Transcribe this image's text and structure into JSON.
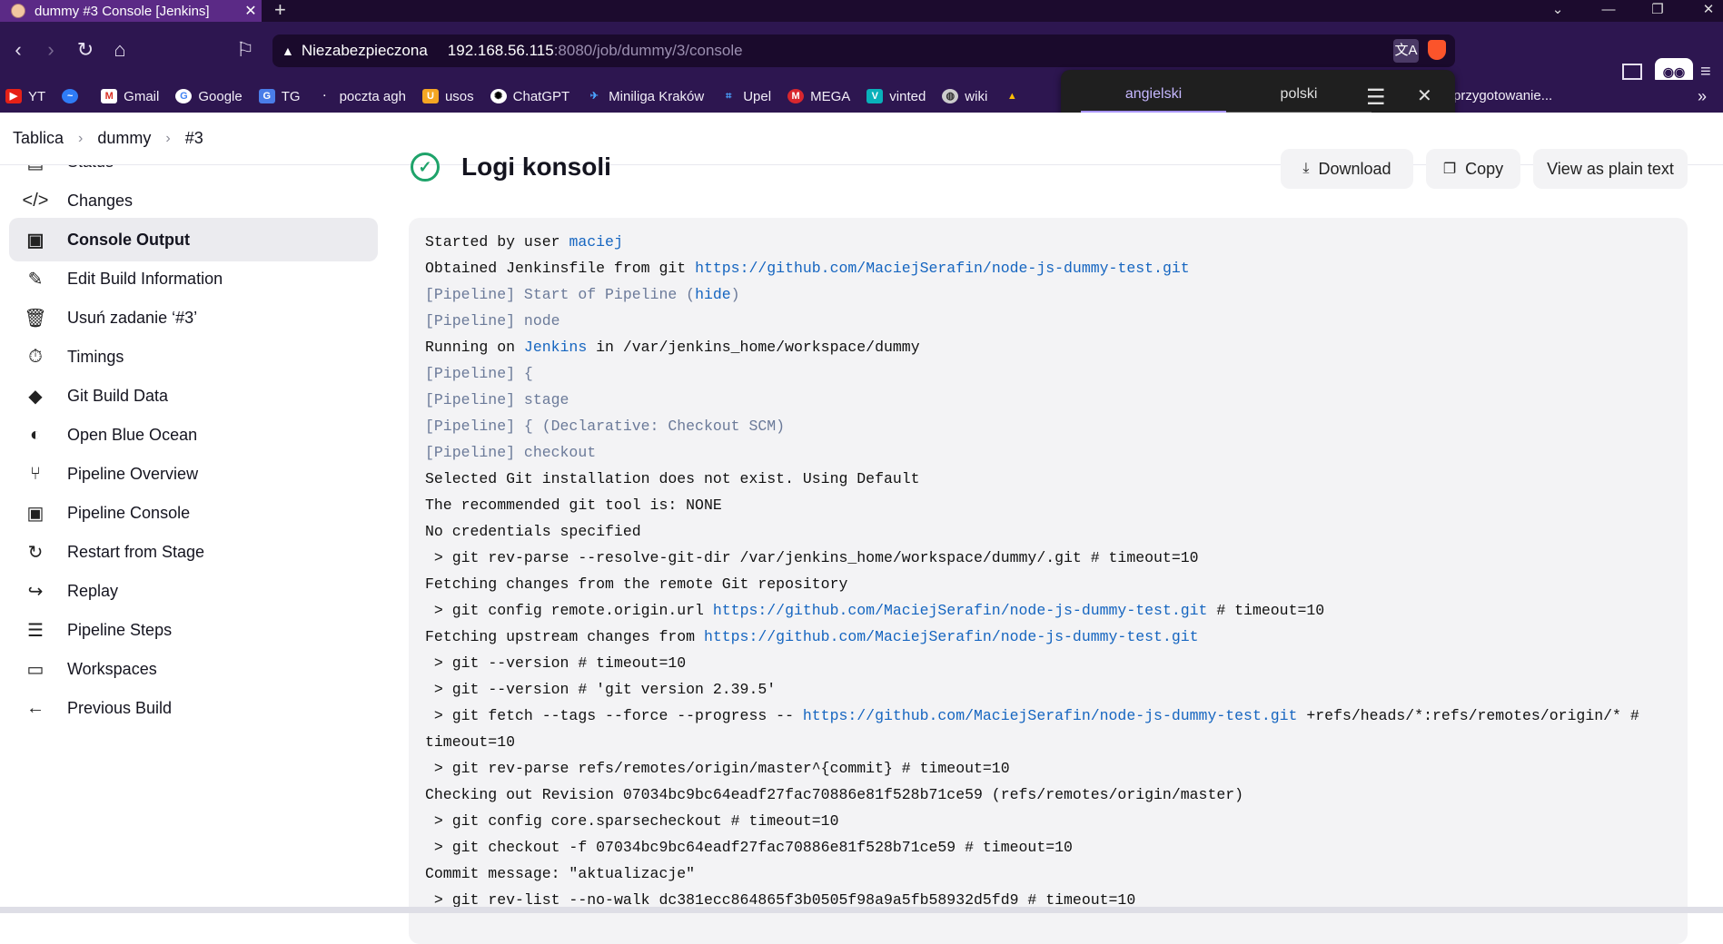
{
  "browser": {
    "tab_title": "dummy #3 Console [Jenkins]",
    "url_security": "Niezabezpieczona",
    "url_host": "192.168.56.115",
    "url_path": ":8080/job/dummy/3/console",
    "bookmarks": [
      "YT",
      "Gmail",
      "Google",
      "TG",
      "poczta agh",
      "usos",
      "ChatGPT",
      "Miniliga Kraków",
      "Upel",
      "MEGA",
      "vinted",
      "wiki"
    ],
    "bookmark_overflow": "przygotowanie..."
  },
  "translate_popup": {
    "lang_from": "angielski",
    "lang_to": "polski"
  },
  "breadcrumb": [
    "Tablica",
    "dummy",
    "#3"
  ],
  "sidebar": [
    {
      "label": "Status",
      "icon": "status-icon",
      "glyph": "▤"
    },
    {
      "label": "Changes",
      "icon": "code-icon",
      "glyph": "</>"
    },
    {
      "label": "Console Output",
      "icon": "terminal-icon",
      "glyph": "▣",
      "active": true
    },
    {
      "label": "Edit Build Information",
      "icon": "edit-icon",
      "glyph": "✎"
    },
    {
      "label": "Usuń zadanie ‘#3’",
      "icon": "trash-icon",
      "glyph": "🗑"
    },
    {
      "label": "Timings",
      "icon": "stopwatch-icon",
      "glyph": "⏱"
    },
    {
      "label": "Git Build Data",
      "icon": "git-icon",
      "glyph": "◆"
    },
    {
      "label": "Open Blue Ocean",
      "icon": "blue-ocean-icon",
      "glyph": "◐"
    },
    {
      "label": "Pipeline Overview",
      "icon": "pipeline-graph-icon",
      "glyph": "⑂"
    },
    {
      "label": "Pipeline Console",
      "icon": "terminal-icon",
      "glyph": "▣"
    },
    {
      "label": "Restart from Stage",
      "icon": "restart-icon",
      "glyph": "↻"
    },
    {
      "label": "Replay",
      "icon": "replay-icon",
      "glyph": "↪"
    },
    {
      "label": "Pipeline Steps",
      "icon": "list-icon",
      "glyph": "☰"
    },
    {
      "label": "Workspaces",
      "icon": "folder-icon",
      "glyph": "▭"
    },
    {
      "label": "Previous Build",
      "icon": "arrow-left-icon",
      "glyph": "←"
    }
  ],
  "main": {
    "title": "Logi konsoli",
    "download_label": "Download",
    "copy_label": "Copy",
    "plain_label": "View as plain text"
  },
  "console": [
    {
      "parts": [
        {
          "t": "Started by user "
        },
        {
          "t": "maciej",
          "k": "link"
        }
      ]
    },
    {
      "parts": [
        {
          "t": "Obtained Jenkinsfile from git "
        },
        {
          "t": "https://github.com/MaciejSerafin/node-js-dummy-test.git",
          "k": "link"
        }
      ]
    },
    {
      "parts": [
        {
          "t": "[Pipeline] Start of Pipeline (",
          "k": "pl"
        },
        {
          "t": "hide",
          "k": "link"
        },
        {
          "t": ")",
          "k": "pl"
        }
      ]
    },
    {
      "parts": [
        {
          "t": "[Pipeline] node",
          "k": "pl"
        }
      ]
    },
    {
      "parts": [
        {
          "t": "Running on "
        },
        {
          "t": "Jenkins",
          "k": "link"
        },
        {
          "t": " in /var/jenkins_home/workspace/dummy"
        }
      ]
    },
    {
      "parts": [
        {
          "t": "[Pipeline] {",
          "k": "pl"
        }
      ]
    },
    {
      "parts": [
        {
          "t": "[Pipeline] stage",
          "k": "pl"
        }
      ]
    },
    {
      "parts": [
        {
          "t": "[Pipeline] { (Declarative: Checkout SCM)",
          "k": "pl"
        }
      ]
    },
    {
      "parts": [
        {
          "t": "[Pipeline] checkout",
          "k": "pl"
        }
      ]
    },
    {
      "parts": [
        {
          "t": "Selected Git installation does not exist. Using Default"
        }
      ]
    },
    {
      "parts": [
        {
          "t": "The recommended git tool is: NONE"
        }
      ]
    },
    {
      "parts": [
        {
          "t": "No credentials specified"
        }
      ]
    },
    {
      "parts": [
        {
          "t": " > git rev-parse --resolve-git-dir /var/jenkins_home/workspace/dummy/.git # timeout=10"
        }
      ]
    },
    {
      "parts": [
        {
          "t": "Fetching changes from the remote Git repository"
        }
      ]
    },
    {
      "parts": [
        {
          "t": " > git config remote.origin.url "
        },
        {
          "t": "https://github.com/MaciejSerafin/node-js-dummy-test.git",
          "k": "link"
        },
        {
          "t": " # timeout=10"
        }
      ]
    },
    {
      "parts": [
        {
          "t": "Fetching upstream changes from "
        },
        {
          "t": "https://github.com/MaciejSerafin/node-js-dummy-test.git",
          "k": "link"
        }
      ]
    },
    {
      "parts": [
        {
          "t": " > git --version # timeout=10"
        }
      ]
    },
    {
      "parts": [
        {
          "t": " > git --version # 'git version 2.39.5'"
        }
      ]
    },
    {
      "parts": [
        {
          "t": " > git fetch --tags --force --progress -- "
        },
        {
          "t": "https://github.com/MaciejSerafin/node-js-dummy-test.git",
          "k": "link"
        },
        {
          "t": " +refs/heads/*:refs/remotes/origin/* # timeout=10"
        }
      ]
    },
    {
      "parts": [
        {
          "t": " > git rev-parse refs/remotes/origin/master^{commit} # timeout=10"
        }
      ]
    },
    {
      "parts": [
        {
          "t": "Checking out Revision 07034bc9bc64eadf27fac70886e81f528b71ce59 (refs/remotes/origin/master)"
        }
      ]
    },
    {
      "parts": [
        {
          "t": " > git config core.sparsecheckout # timeout=10"
        }
      ]
    },
    {
      "parts": [
        {
          "t": " > git checkout -f 07034bc9bc64eadf27fac70886e81f528b71ce59 # timeout=10"
        }
      ]
    },
    {
      "parts": [
        {
          "t": "Commit message: \"aktualizacje\""
        }
      ]
    },
    {
      "parts": [
        {
          "t": " > git rev-list --no-walk dc381ecc864865f3b0505f98a9a5fb58932d5fd9 # timeout=10"
        }
      ]
    }
  ]
}
